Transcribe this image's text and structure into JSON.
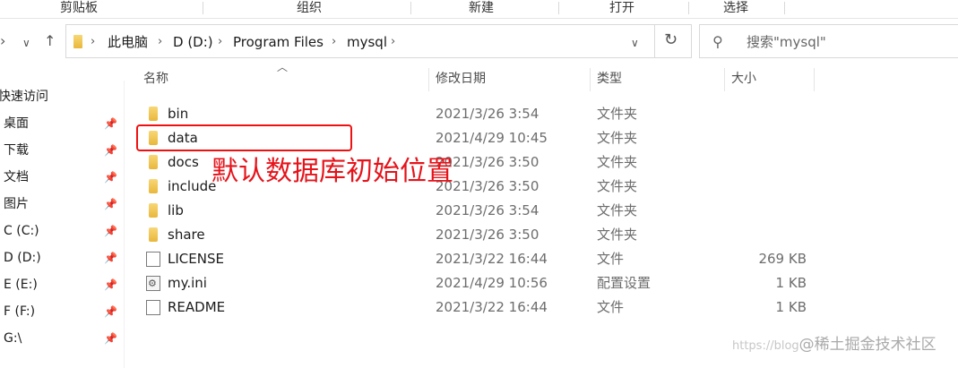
{
  "ribbon": {
    "groups": [
      "剪贴板",
      "组织",
      "新建",
      "打开",
      "选择"
    ]
  },
  "address": {
    "crumbs": [
      "此电脑",
      "D (D:)",
      "Program Files",
      "mysql"
    ],
    "search_placeholder": "搜索\"mysql\""
  },
  "nav": {
    "items": [
      {
        "label": "快速访问",
        "pinned": false
      },
      {
        "label": "桌面",
        "pinned": true
      },
      {
        "label": "下载",
        "pinned": true
      },
      {
        "label": "文档",
        "pinned": true
      },
      {
        "label": "图片",
        "pinned": true
      },
      {
        "label": "C (C:)",
        "pinned": true
      },
      {
        "label": "D (D:)",
        "pinned": true
      },
      {
        "label": "E (E:)",
        "pinned": true
      },
      {
        "label": "F (F:)",
        "pinned": true
      },
      {
        "label": "G:\\",
        "pinned": true
      }
    ]
  },
  "columns": {
    "name": "名称",
    "date": "修改日期",
    "type": "类型",
    "size": "大小"
  },
  "files": [
    {
      "name": "bin",
      "date": "2021/3/26 3:54",
      "type": "文件夹",
      "size": "",
      "icon": "folder-icon"
    },
    {
      "name": "data",
      "date": "2021/4/29 10:45",
      "type": "文件夹",
      "size": "",
      "icon": "folder-icon"
    },
    {
      "name": "docs",
      "date": "2021/3/26 3:50",
      "type": "文件夹",
      "size": "",
      "icon": "folder-icon"
    },
    {
      "name": "include",
      "date": "2021/3/26 3:50",
      "type": "文件夹",
      "size": "",
      "icon": "folder-icon"
    },
    {
      "name": "lib",
      "date": "2021/3/26 3:54",
      "type": "文件夹",
      "size": "",
      "icon": "folder-icon"
    },
    {
      "name": "share",
      "date": "2021/3/26 3:50",
      "type": "文件夹",
      "size": "",
      "icon": "folder-icon"
    },
    {
      "name": "LICENSE",
      "date": "2021/3/22 16:44",
      "type": "文件",
      "size": "269 KB",
      "icon": "file-icon"
    },
    {
      "name": "my.ini",
      "date": "2021/4/29 10:56",
      "type": "配置设置",
      "size": "1 KB",
      "icon": "settings-file-icon"
    },
    {
      "name": "README",
      "date": "2021/3/22 16:44",
      "type": "文件",
      "size": "1 KB",
      "icon": "file-icon"
    }
  ],
  "annotation": {
    "text": "默认数据库初始位置",
    "color": "#e5141b"
  },
  "watermark": {
    "prefix": "https://blog",
    "text": "@稀土掘金技术社区"
  }
}
